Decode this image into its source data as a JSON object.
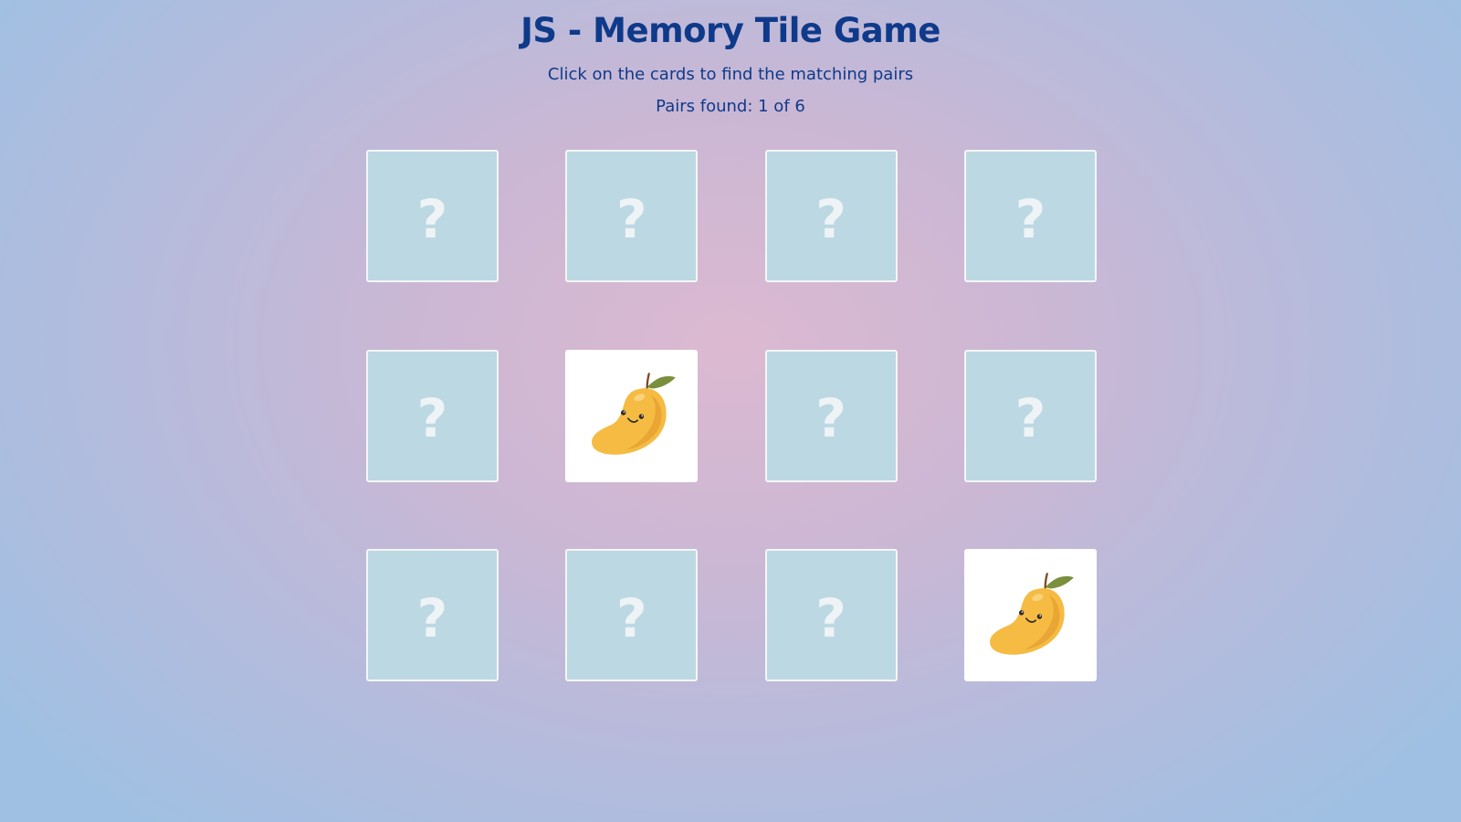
{
  "header": {
    "title": "JS - Memory Tile Game",
    "instructions": "Click on the cards to find the matching pairs",
    "status": "Pairs found: 1 of 6"
  },
  "game": {
    "pairs_found": 1,
    "total_pairs": 6,
    "hidden_symbol": "?",
    "cards": [
      {
        "state": "hidden",
        "face": "?"
      },
      {
        "state": "hidden",
        "face": "?"
      },
      {
        "state": "hidden",
        "face": "?"
      },
      {
        "state": "hidden",
        "face": "?"
      },
      {
        "state": "hidden",
        "face": "?"
      },
      {
        "state": "revealed",
        "icon": "mango-icon"
      },
      {
        "state": "hidden",
        "face": "?"
      },
      {
        "state": "hidden",
        "face": "?"
      },
      {
        "state": "hidden",
        "face": "?"
      },
      {
        "state": "hidden",
        "face": "?"
      },
      {
        "state": "hidden",
        "face": "?"
      },
      {
        "state": "revealed",
        "icon": "mango-icon"
      }
    ]
  },
  "colors": {
    "text": "#0f3a8a",
    "card_back": "#bcd8e3",
    "card_face": "#ffffff",
    "mango": "#f5bb42"
  }
}
